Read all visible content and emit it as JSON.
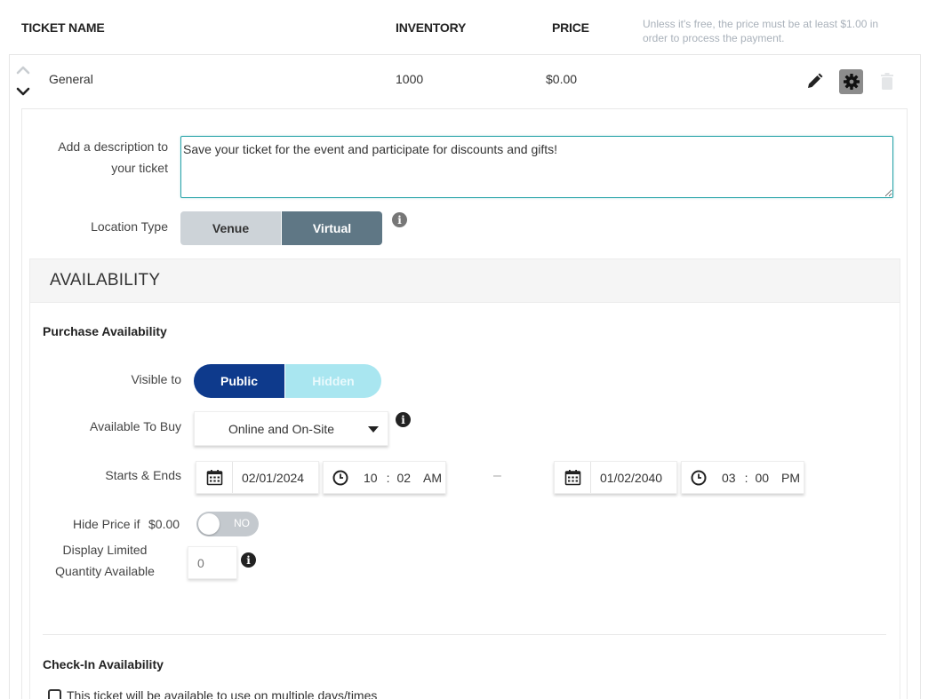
{
  "header": {
    "ticket_name": "TICKET NAME",
    "inventory": "INVENTORY",
    "price": "PRICE",
    "note": "Unless it's free, the price must be at least $1.00 in order to process the payment."
  },
  "ticket": {
    "name": "General",
    "inventory": "1000",
    "price": "$0.00"
  },
  "details": {
    "description_label": "Add a description to your ticket",
    "description_value": "Save your ticket for the event and participate for discounts and gifts!",
    "location_label": "Location Type",
    "location_options": [
      "Venue",
      "Virtual"
    ],
    "location_selected": "Virtual"
  },
  "availability": {
    "title": "AVAILABILITY",
    "purchase_title": "Purchase Availability",
    "visible_label": "Visible to",
    "visible_options": [
      "Public",
      "Hidden"
    ],
    "visible_selected": "Public",
    "available_label": "Available To Buy",
    "available_value": "Online and On-Site",
    "starts_ends_label": "Starts & Ends",
    "start_date": "02/01/2024",
    "start_hour": "10",
    "start_minute": "02",
    "start_ampm": "AM",
    "end_date": "01/02/2040",
    "end_hour": "03",
    "end_minute": "00",
    "end_ampm": "PM",
    "range_sep": "–",
    "hide_price_label": "Hide Price if",
    "hide_price_amount": "$0.00",
    "hide_price_toggle": "NO",
    "display_limited_label": "Display Limited Quantity Available",
    "display_limited_placeholder": "0",
    "checkin_title": "Check-In Availability",
    "multiple_days_label": "This ticket will be available to use on multiple days/times"
  },
  "colors": {
    "teal": "#27a3a8",
    "venue_bg": "#cdd3d8",
    "virtual_bg": "#5f7785",
    "public_bg": "#0e3a8c",
    "hidden_bg": "#a9e6f0",
    "toggle_bg": "#c4c9ce"
  },
  "icons": [
    "chevron-up-icon",
    "chevron-down-icon",
    "pencil-icon",
    "gear-icon",
    "trash-icon",
    "info-icon",
    "calendar-icon",
    "clock-icon"
  ]
}
